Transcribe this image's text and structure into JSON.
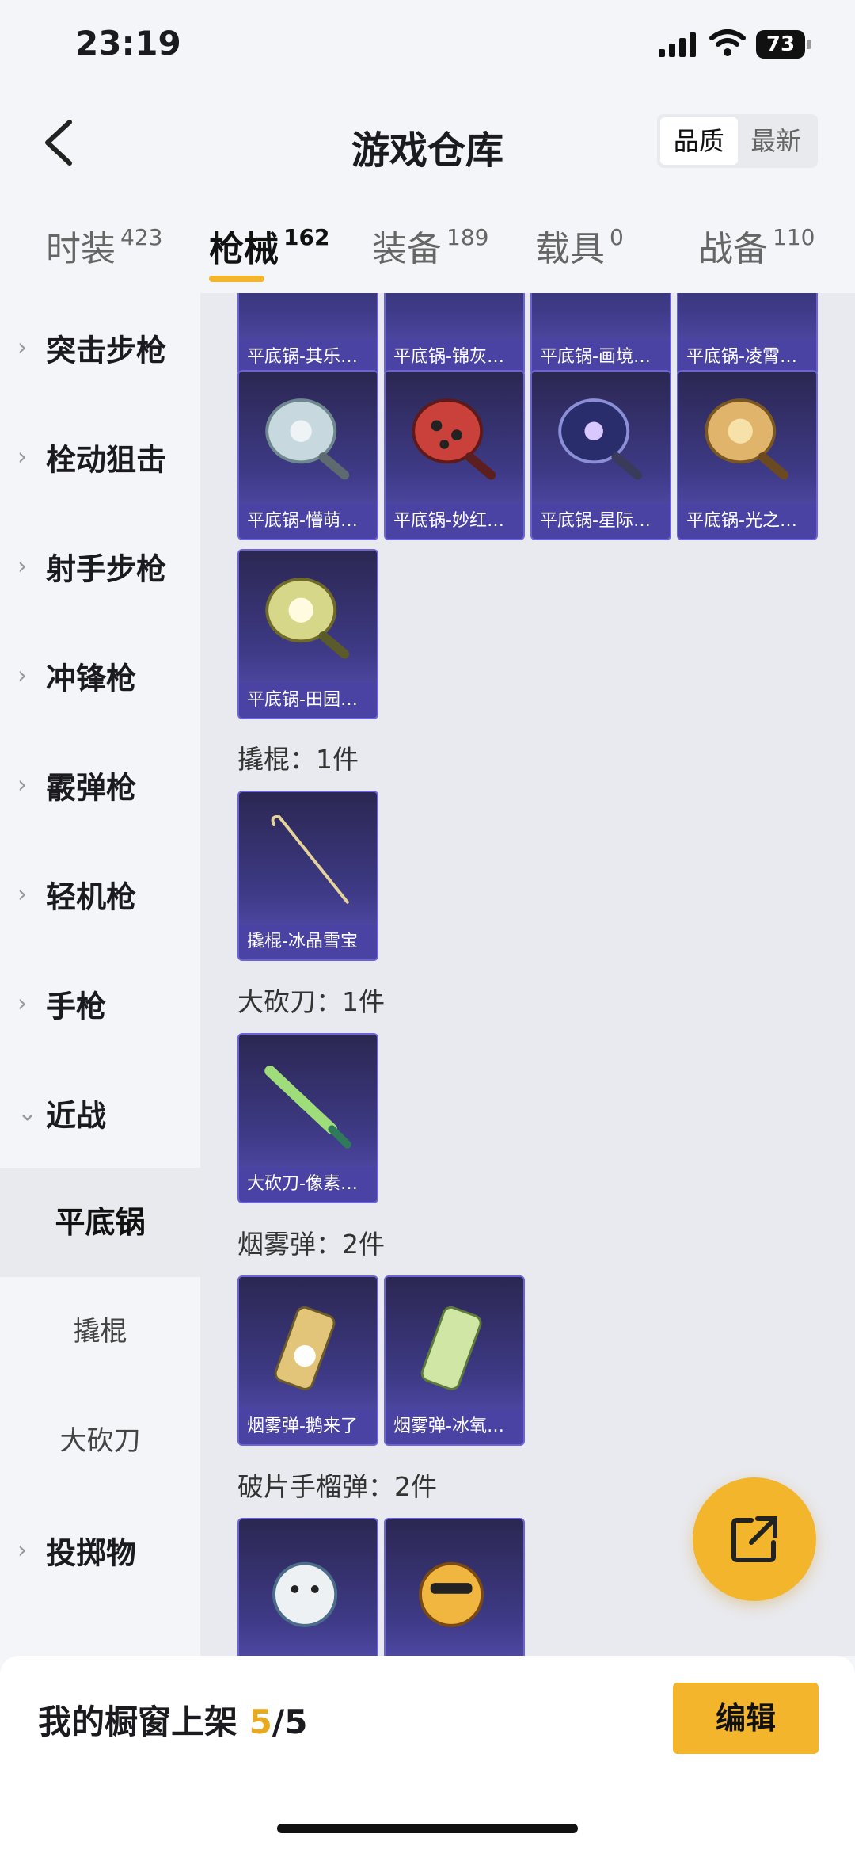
{
  "status": {
    "time": "23:19",
    "battery": "73"
  },
  "header": {
    "title": "游戏仓库",
    "sort": [
      "品质",
      "最新"
    ]
  },
  "tabs": [
    {
      "label": "时装",
      "count": "423"
    },
    {
      "label": "枪械",
      "count": "162"
    },
    {
      "label": "装备",
      "count": "189"
    },
    {
      "label": "载具",
      "count": "0"
    },
    {
      "label": "战备",
      "count": "110"
    }
  ],
  "sidebar": {
    "items": [
      "突击步枪",
      "栓动狙击",
      "射手步枪",
      "冲锋枪",
      "霰弹枪",
      "轻机枪",
      "手枪",
      "近战"
    ],
    "sub_items": [
      "平底锅",
      "撬棍",
      "大砍刀"
    ],
    "last_item": "投掷物"
  },
  "groups": {
    "pan_row1": [
      "平底锅-其乐…",
      "平底锅-锦灰…",
      "平底锅-画境…",
      "平底锅-凌霄…"
    ],
    "pan_row2": [
      "平底锅-懵萌…",
      "平底锅-妙红…",
      "平底锅-星际…",
      "平底锅-光之…"
    ],
    "pan_row3": [
      "平底锅-田园…"
    ],
    "crowbar": {
      "title": "撬棍：1件",
      "items": [
        "撬棍-冰晶雪宝"
      ]
    },
    "machete": {
      "title": "大砍刀：1件",
      "items": [
        "大砍刀-像素…"
      ]
    },
    "smoke": {
      "title": "烟雾弹：2件",
      "items": [
        "烟雾弹-鹅来了",
        "烟雾弹-冰氧…"
      ]
    },
    "frag": {
      "title": "破片手榴弹：2件",
      "items": [
        "",
        ""
      ]
    }
  },
  "bottom": {
    "label": "我的橱窗上架",
    "count": "5",
    "total": "/5",
    "edit": "编辑"
  },
  "colors": {
    "accent": "#f2b52b",
    "card": "#3e3a86"
  }
}
